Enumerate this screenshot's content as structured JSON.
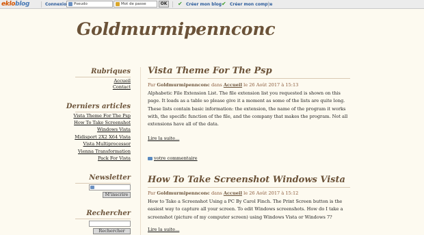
{
  "topbar": {
    "logo_part1": "eklo",
    "logo_part2": "blog",
    "connexion": "Connexion :",
    "pseudo_placeholder": "Pseudo",
    "password_placeholder": "Mot de passe",
    "ok_label": "OK",
    "create_blog": "Créer mon blog",
    "create_account": "Créer mon compte"
  },
  "blog": {
    "title": "Goldmurmipennconc"
  },
  "sidebar": {
    "rubriques_title": "Rubriques",
    "rubriques": [
      "Accueil",
      "Contact"
    ],
    "recent_title": "Derniers articles",
    "recent": [
      "Vista Theme For The Psp",
      "How To Take Screenshot",
      "Windows Vista",
      "Midisport 2X2 X64 Vista",
      "Vista Multiprocessor",
      "Vienna Transformation",
      "Pack For Vista"
    ],
    "newsletter_title": "Newsletter",
    "newsletter_button": "M'inscrire",
    "search_title": "Rechercher",
    "search_button": "Rechercher"
  },
  "posts": [
    {
      "title": "Vista Theme For The Psp",
      "meta_par": "Par",
      "meta_author": "Goldmurmipennconc",
      "meta_dans": "dans",
      "meta_category": "Accueil",
      "meta_date": "le 26 Août 2017 à 15:13",
      "body": "Alphabetic File Extension List. The file extension list you requested is shown on this page. It loads as a table so please give it a moment as some of the lists are quite long. These lists contain basic information: the extension, the name of the program it works with, the specific function of the file, and the company that makes the program. Not all extensions have all of the data.",
      "read_more": "Lire la suite...",
      "comment": "votre commentaire"
    },
    {
      "title": "How To Take Screenshot Windows Vista",
      "meta_par": "Par",
      "meta_author": "Goldmurmipennconc",
      "meta_dans": "dans",
      "meta_category": "Accueil",
      "meta_date": "le 26 Août 2017 à 15:12",
      "body": "How to Take a Screenshot Using a PC By Carol Finch. The Print Screen button is the easiest way to capture all your screen. To edit Windows screenshots. How do I take a screenshot (picture of my computer screen) using Windows Vista or Windows 7?",
      "read_more": "Lire la suite..."
    }
  ]
}
